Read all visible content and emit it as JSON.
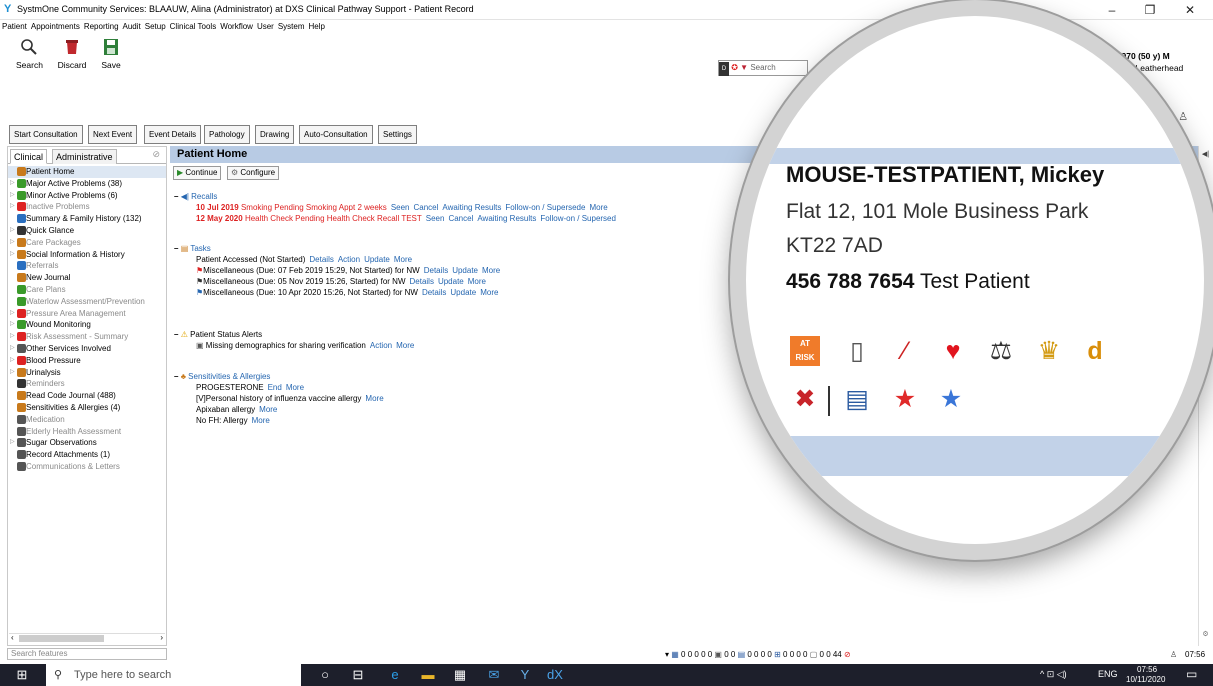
{
  "window": {
    "title": "SystmOne Community Services: BLAAUW, Alina (Administrator) at DXS Clinical Pathway Support - Patient Record",
    "controls": [
      "–",
      "❐",
      "✕"
    ]
  },
  "menu": [
    "Patient",
    "Appointments",
    "Reporting",
    "Audit",
    "Setup",
    "Clinical Tools",
    "Workflow",
    "User",
    "System",
    "Help"
  ],
  "toolbar": {
    "search_label": "Search",
    "discard_label": "Discard",
    "save_label": "Save"
  },
  "dxs": {
    "search_placeholder": "Search"
  },
  "patient_banner": {
    "dob": "01 Jan 1970 (50 y) M",
    "address_tail": "ls Road, Leatherhead"
  },
  "buttons": {
    "start_consultation": "Start Consultation",
    "next_event": "Next Event",
    "event_details": "Event Details",
    "pathology": "Pathology",
    "drawing": "Drawing",
    "auto_consultation": "Auto-Consultation",
    "settings": "Settings"
  },
  "sidebar": {
    "tabs": [
      "Clinical",
      "Administrative"
    ],
    "items": [
      {
        "label": "Patient Home",
        "grey": false,
        "expand": false,
        "icon": "person-icon",
        "color": "#c87a1c"
      },
      {
        "label": "Major Active Problems (38)",
        "grey": false,
        "expand": true,
        "icon": "lizard-icon",
        "color": "#3a9a2a"
      },
      {
        "label": "Minor Active Problems (6)",
        "grey": false,
        "expand": true,
        "icon": "lizard-icon",
        "color": "#3a9a2a"
      },
      {
        "label": "Inactive Problems",
        "grey": true,
        "expand": true,
        "icon": "warning-flag-icon",
        "color": "#d22"
      },
      {
        "label": "Summary & Family History (132)",
        "grey": false,
        "expand": false,
        "icon": "document-icon",
        "color": "#2a6fc0"
      },
      {
        "label": "Quick Glance",
        "grey": false,
        "expand": true,
        "icon": "eye-icon",
        "color": "#333"
      },
      {
        "label": "Care Packages",
        "grey": true,
        "expand": true,
        "icon": "package-icon",
        "color": "#c87a1c"
      },
      {
        "label": "Social Information & History",
        "grey": false,
        "expand": true,
        "icon": "social-icon",
        "color": "#c87a1c"
      },
      {
        "label": "Referrals",
        "grey": true,
        "expand": false,
        "icon": "arrow-icon",
        "color": "#2a6fc0"
      },
      {
        "label": "New Journal",
        "grey": false,
        "expand": false,
        "icon": "journal-icon",
        "color": "#c87a1c"
      },
      {
        "label": "Care Plans",
        "grey": true,
        "expand": false,
        "icon": "care-plan-icon",
        "color": "#3a9a2a"
      },
      {
        "label": "Waterlow Assessment/Prevention",
        "grey": true,
        "expand": false,
        "icon": "check-icon",
        "color": "#3a9a2a"
      },
      {
        "label": "Pressure Area Management",
        "grey": true,
        "expand": true,
        "icon": "pressure-icon",
        "color": "#d22"
      },
      {
        "label": "Wound Monitoring",
        "grey": false,
        "expand": true,
        "icon": "wound-icon",
        "color": "#3a9a2a"
      },
      {
        "label": "Risk Assessment - Summary",
        "grey": true,
        "expand": true,
        "icon": "risk-icon",
        "color": "#d22"
      },
      {
        "label": "Other Services Involved",
        "grey": false,
        "expand": true,
        "icon": "services-icon",
        "color": "#555"
      },
      {
        "label": "Blood Pressure",
        "grey": false,
        "expand": true,
        "icon": "bp-icon",
        "color": "#d22"
      },
      {
        "label": "Urinalysis",
        "grey": false,
        "expand": true,
        "icon": "urinalysis-icon",
        "color": "#c87a1c"
      },
      {
        "label": "Reminders",
        "grey": true,
        "expand": false,
        "icon": "reminder-icon",
        "color": "#333"
      },
      {
        "label": "Read Code Journal (488)",
        "grey": false,
        "expand": false,
        "icon": "read-code-icon",
        "color": "#c87a1c"
      },
      {
        "label": "Sensitivities & Allergies (4)",
        "grey": false,
        "expand": false,
        "icon": "allergy-icon",
        "color": "#c87a1c"
      },
      {
        "label": "Medication",
        "grey": true,
        "expand": false,
        "icon": "medication-icon",
        "color": "#555"
      },
      {
        "label": "Elderly Health Assessment",
        "grey": true,
        "expand": false,
        "icon": "elderly-icon",
        "color": "#555"
      },
      {
        "label": "Sugar Observations",
        "grey": false,
        "expand": true,
        "icon": "sugar-icon",
        "color": "#555"
      },
      {
        "label": "Record Attachments (1)",
        "grey": false,
        "expand": false,
        "icon": "attachment-icon",
        "color": "#555"
      },
      {
        "label": "Communications & Letters",
        "grey": true,
        "expand": false,
        "icon": "letters-icon",
        "color": "#555"
      }
    ]
  },
  "main": {
    "title": "Patient Home",
    "continue_label": "Continue",
    "configure_label": "Configure",
    "recalls": {
      "heading": "Recalls",
      "rows": [
        {
          "date": "10 Jul 2019",
          "text": "Smoking Pending Smoking Appt 2 weeks",
          "links": [
            "Seen",
            "Cancel",
            "Awaiting Results",
            "Follow-on / Supersede",
            "More"
          ]
        },
        {
          "date": "12 May 2020",
          "text": "Health Check Pending Health Check Recall TEST",
          "links": [
            "Seen",
            "Cancel",
            "Awaiting Results",
            "Follow-on / Supersed"
          ]
        }
      ]
    },
    "tasks": {
      "heading": "Tasks",
      "rows": [
        {
          "text": "Patient Accessed (Not Started)",
          "links": [
            "Details",
            "Action",
            "Update",
            "More"
          ]
        },
        {
          "text": "Miscellaneous (Due: 07 Feb 2019 15:29, Not Started) for NW",
          "links": [
            "Details",
            "Update",
            "More"
          ]
        },
        {
          "text": "Miscellaneous (Due: 05 Nov 2019 15:26, Started) for NW",
          "links": [
            "Details",
            "Update",
            "More"
          ]
        },
        {
          "text": "Miscellaneous (Due: 10 Apr 2020 15:26, Not Started) for NW",
          "links": [
            "Details",
            "Update",
            "More"
          ]
        }
      ]
    },
    "alerts": {
      "heading": "Patient Status Alerts",
      "rows": [
        {
          "text": "Missing demographics for sharing verification",
          "links": [
            "Action",
            "More"
          ]
        }
      ]
    },
    "sensitivities": {
      "heading": "Sensitivities & Allergies",
      "rows": [
        {
          "text": "PROGESTERONE",
          "links": [
            "End",
            "More"
          ]
        },
        {
          "text": "[V]Personal history of influenza vaccine allergy",
          "links": [
            "More"
          ]
        },
        {
          "text": "Apixaban allergy",
          "links": [
            "More"
          ]
        },
        {
          "text": "No FH: Allergy",
          "links": [
            "More"
          ]
        }
      ]
    }
  },
  "magnifier": {
    "name": "MOUSE-TESTPATIENT, Mickey",
    "address1": "Flat 12, 101 Mole Business Park",
    "address2": "KT22 7AD",
    "nhs_number": "456 788 7654",
    "patient_type": "Test Patient",
    "at_risk_label": "AT RISK"
  },
  "search_features_placeholder": "Search features",
  "statusbar": {
    "counts": "0 0 0 0 0",
    "counts2": "0 0",
    "counts3": "0 0 0 0",
    "counts4": "0 0 0 0",
    "counts5": "0 0 44",
    "time": "07:56"
  },
  "taskbar": {
    "search_placeholder": "Type here to search",
    "lang": "ENG",
    "time": "07:56",
    "date": "10/11/2020"
  }
}
